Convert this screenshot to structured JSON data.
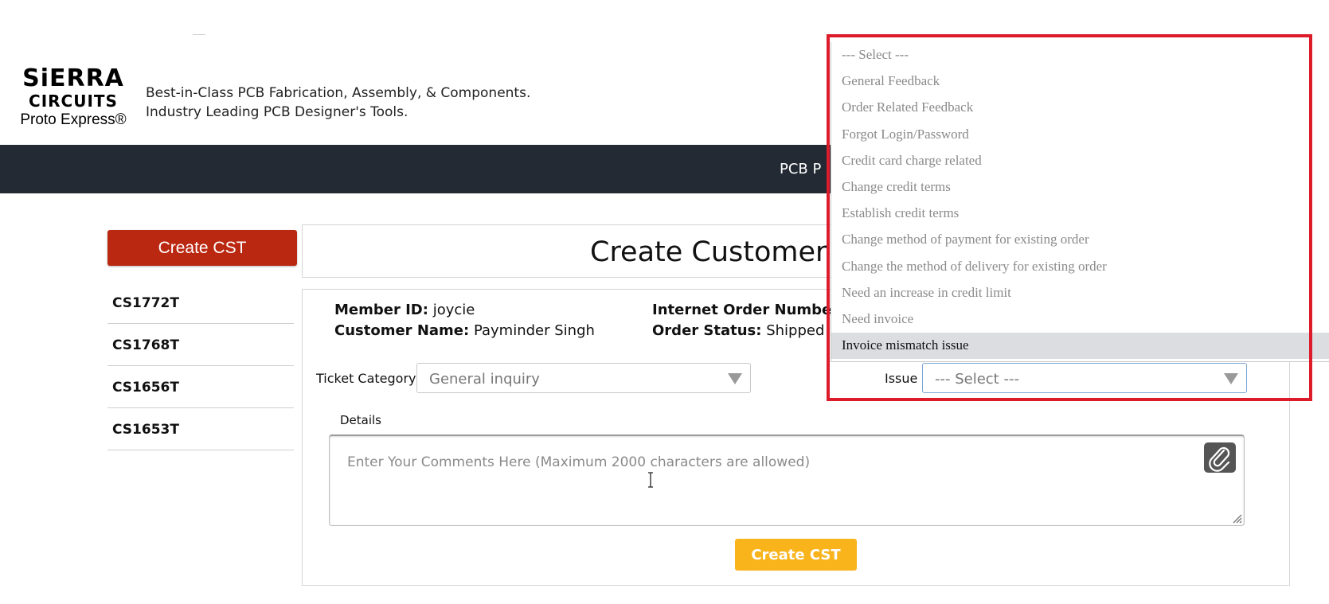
{
  "header": {
    "logo_line1": "SiERRA",
    "logo_line2": "CIRCUITS",
    "logo_line3": "Proto Express®",
    "tagline_line1": "Best-in-Class PCB Fabrication, Assembly, & Components.",
    "tagline_line2": "Industry Leading PCB Designer's Tools."
  },
  "nav": {
    "item_visible": "PCB P"
  },
  "sidebar": {
    "create_label": "Create CST",
    "items": [
      "CS1772T",
      "CS1768T",
      "CS1656T",
      "CS1653T"
    ]
  },
  "main": {
    "title": "Create Customer S",
    "member_id_label": "Member ID:",
    "member_id_value": "joycie",
    "customer_name_label": "Customer Name:",
    "customer_name_value": "Payminder Singh",
    "order_number_label": "Internet Order Numbe",
    "order_status_label": "Order Status:",
    "order_status_value": "Shipped",
    "ticket_category_label": "Ticket Category",
    "ticket_category_value": "General inquiry",
    "issue_label": "Issue",
    "issue_value": "--- Select ---",
    "details_label": "Details",
    "details_placeholder": "Enter Your Comments Here (Maximum 2000 characters are allowed)",
    "create_button": "Create CST"
  },
  "dropdown": {
    "options": [
      "--- Select ---",
      "General Feedback",
      "Order Related Feedback",
      "Forgot Login/Password",
      "Credit card charge related",
      "Change credit terms",
      "Establish credit terms",
      "Change method of payment for existing order",
      "Change the method of delivery for existing order",
      "Need an increase in credit limit",
      "Need invoice",
      "Invoice mismatch issue"
    ],
    "highlighted": "Invoice mismatch issue"
  },
  "colors": {
    "nav_bg": "#232a33",
    "sidebar_button": "#bb2812",
    "create_button": "#f9b41c",
    "highlight_box": "#dc1c2b"
  }
}
